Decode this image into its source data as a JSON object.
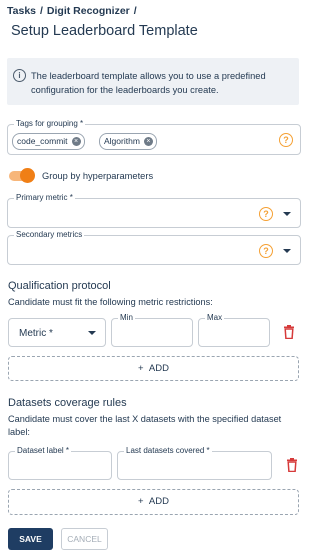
{
  "breadcrumb": {
    "items": [
      "Tasks",
      "Digit Recognizer"
    ],
    "separator": "/"
  },
  "page_title": "Setup Leaderboard Template",
  "info": {
    "text": "The leaderboard template allows you to use a predefined configuration for the leaderboards you  create."
  },
  "tags": {
    "label": "Tags for grouping *",
    "chips": [
      "code_commit",
      "Algorithm"
    ]
  },
  "group_toggle": {
    "label": "Group by hyperparameters",
    "on": true
  },
  "primary_metric": {
    "label": "Primary metric *"
  },
  "secondary_metrics": {
    "label": "Secondary metrics"
  },
  "qualification": {
    "title": "Qualification protocol",
    "description": "Candidate must fit the following metric restrictions:",
    "metric_select": "Metric *",
    "min_label": "Min",
    "max_label": "Max",
    "add_label": "ADD"
  },
  "datasets": {
    "title": "Datasets coverage rules",
    "description": "Candidate must cover the last X datasets with the specified dataset label:",
    "dataset_label": "Dataset label *",
    "last_covered_label": "Last datasets covered *",
    "add_label": "ADD"
  },
  "footer": {
    "save_label": "SAVE",
    "cancel_label": "CANCEL"
  },
  "colors": {
    "accent": "#f07f16",
    "primary": "#1f3d63",
    "danger": "#d63a3a",
    "help": "#f5a033"
  },
  "icons": [
    "info-icon",
    "help-icon",
    "chevron-down-icon",
    "trash-icon",
    "plus-icon",
    "close-icon"
  ]
}
